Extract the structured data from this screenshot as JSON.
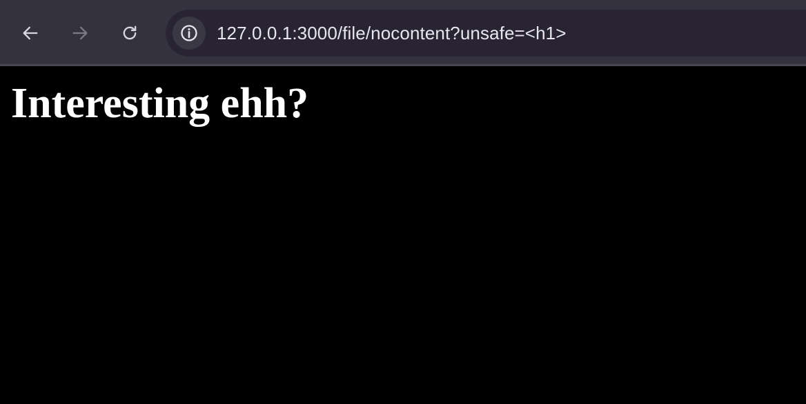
{
  "toolbar": {
    "back_icon": "arrow-left-icon",
    "forward_icon": "arrow-right-icon",
    "reload_icon": "reload-icon",
    "site_info_icon": "info-icon"
  },
  "address_bar": {
    "url": "127.0.0.1:3000/file/nocontent?unsafe=<h1>"
  },
  "page": {
    "heading": "Interesting ehh?"
  },
  "colors": {
    "toolbar_bg": "#35323f",
    "omnibox_bg": "#282433",
    "page_bg": "#000000",
    "text": "#ffffff"
  }
}
